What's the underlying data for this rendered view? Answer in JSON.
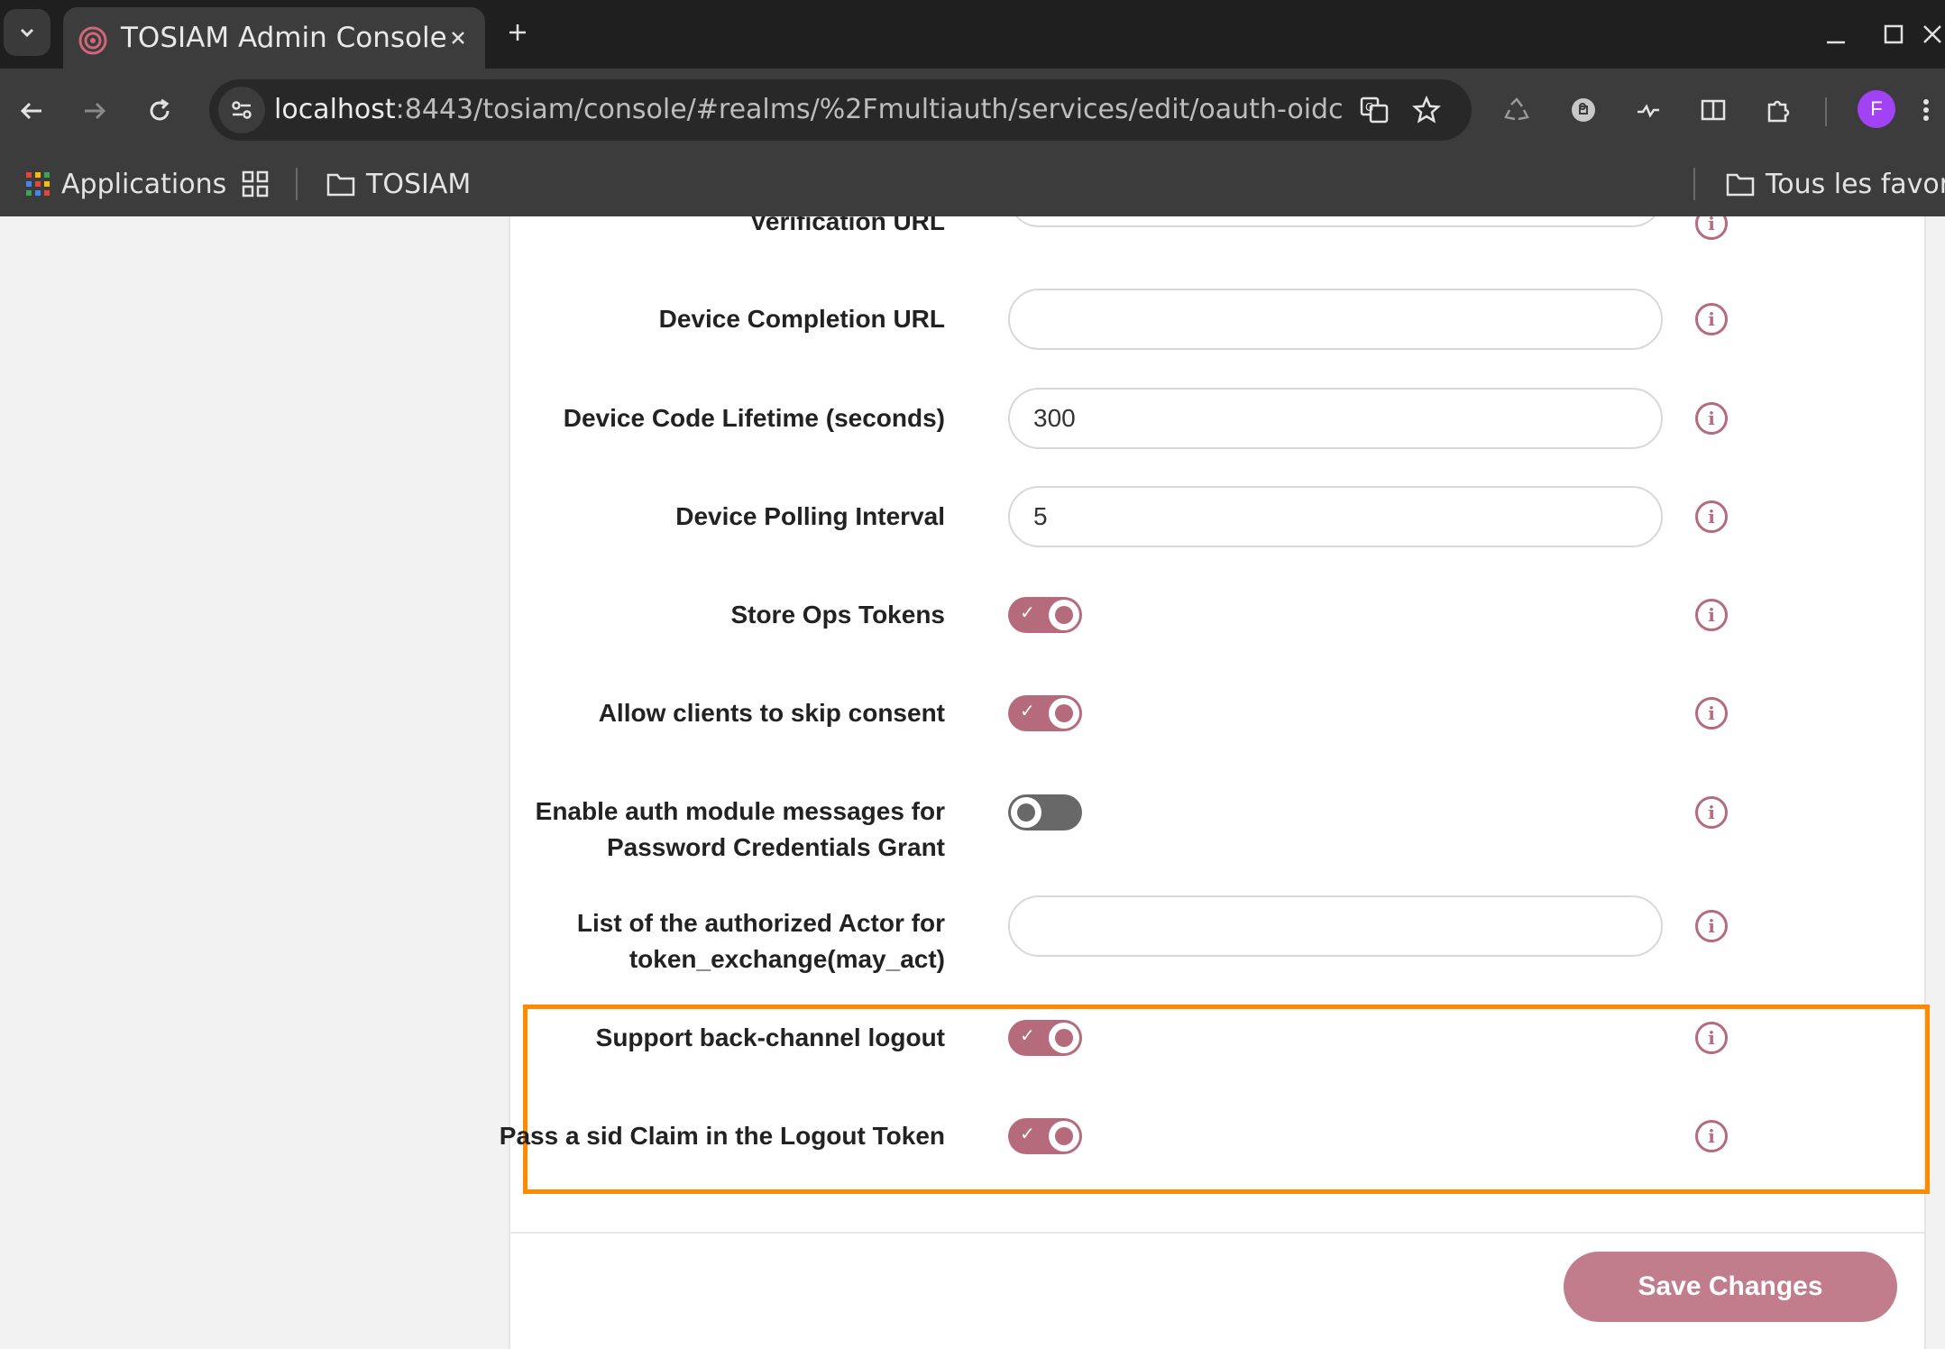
{
  "browser": {
    "tab_title": "TOSIAM Admin Console",
    "url_host": "localhost",
    "url_rest": ":8443/tosiam/console/#realms/%2Fmultiauth/services/edit/oauth-oidc",
    "profile_initial": "F",
    "bookmarks": {
      "apps": "Applications",
      "folder1": "TOSIAM",
      "all": "Tous les favoris"
    },
    "colors": {
      "tab_bg": "#3c3c3c",
      "frame_bg": "#1f1f1f",
      "avatar": "#a142f4"
    }
  },
  "form": {
    "fields": {
      "verification_url": {
        "label": "Verification URL",
        "value": ""
      },
      "device_completion_url": {
        "label": "Device Completion URL",
        "value": ""
      },
      "device_code_lifetime": {
        "label": "Device Code Lifetime (seconds)",
        "value": "300"
      },
      "device_polling_interval": {
        "label": "Device Polling Interval",
        "value": "5"
      },
      "store_ops_tokens": {
        "label": "Store Ops Tokens",
        "enabled": true
      },
      "skip_consent": {
        "label": "Allow clients to skip consent",
        "enabled": true
      },
      "auth_module_messages": {
        "label_line1": "Enable auth module messages for",
        "label_line2": "Password Credentials Grant",
        "enabled": false
      },
      "may_act": {
        "label_line1": "List of the authorized Actor for",
        "label_line2": "token_exchange(may_act)",
        "value": ""
      },
      "back_channel_logout": {
        "label": "Support back-channel logout",
        "enabled": true
      },
      "sid_claim": {
        "label": "Pass a sid Claim in the Logout Token",
        "enabled": true
      }
    },
    "info_glyph": "i",
    "toggle_check": "✓",
    "save_label": "Save Changes",
    "colors": {
      "accent": "#b56b7b",
      "highlight": "#ff8a00",
      "save_button": "#c27d8d"
    }
  }
}
